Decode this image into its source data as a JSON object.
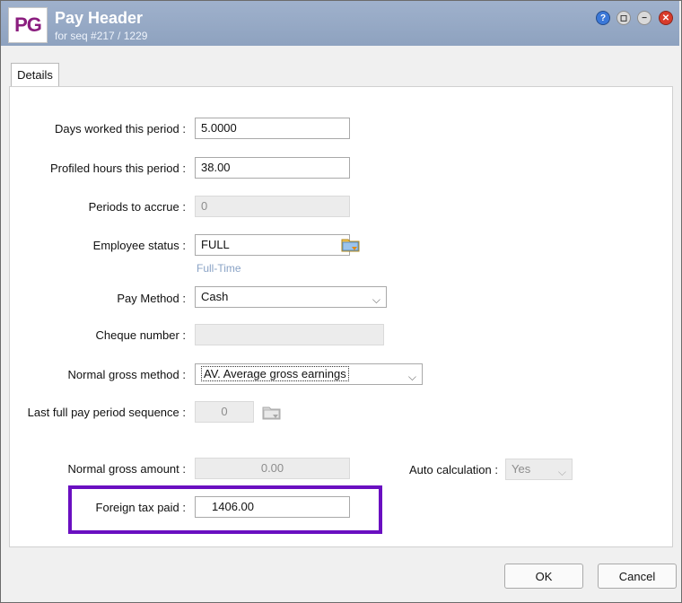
{
  "window": {
    "logo_text": "PG",
    "title": "Pay Header",
    "subtitle": "for seq #217 / 1229",
    "controls": {
      "help": "?",
      "restore": "◻",
      "minimize": "−",
      "close": "✕"
    }
  },
  "tabs": [
    {
      "label": "Details"
    }
  ],
  "form": {
    "days_worked": {
      "label": "Days worked this period :",
      "value": "5.0000"
    },
    "profiled_hours": {
      "label": "Profiled hours this period :",
      "value": "38.00"
    },
    "periods_to_accrue": {
      "label": "Periods to accrue :",
      "value": "0"
    },
    "employee_status": {
      "label": "Employee status :",
      "value": "FULL",
      "hint": "Full-Time"
    },
    "pay_method": {
      "label": "Pay Method :",
      "value": "Cash"
    },
    "cheque_number": {
      "label": "Cheque number :",
      "value": ""
    },
    "normal_gross_method": {
      "label": "Normal gross method :",
      "value": "AV. Average gross earnings"
    },
    "last_full_pay_period_sequence": {
      "label": "Last full pay period sequence :",
      "value": "0"
    },
    "normal_gross_amount": {
      "label": "Normal gross amount :",
      "value": "0.00"
    },
    "auto_calculation": {
      "label": "Auto calculation :",
      "value": "Yes"
    },
    "foreign_tax_paid": {
      "label": "Foreign tax paid :",
      "value": "1406.00"
    }
  },
  "buttons": {
    "ok": "OK",
    "cancel": "Cancel"
  },
  "colors": {
    "titlebar": "#9fb1cc",
    "highlight": "#6a0fc1",
    "hint_text": "#8aa3c6"
  }
}
